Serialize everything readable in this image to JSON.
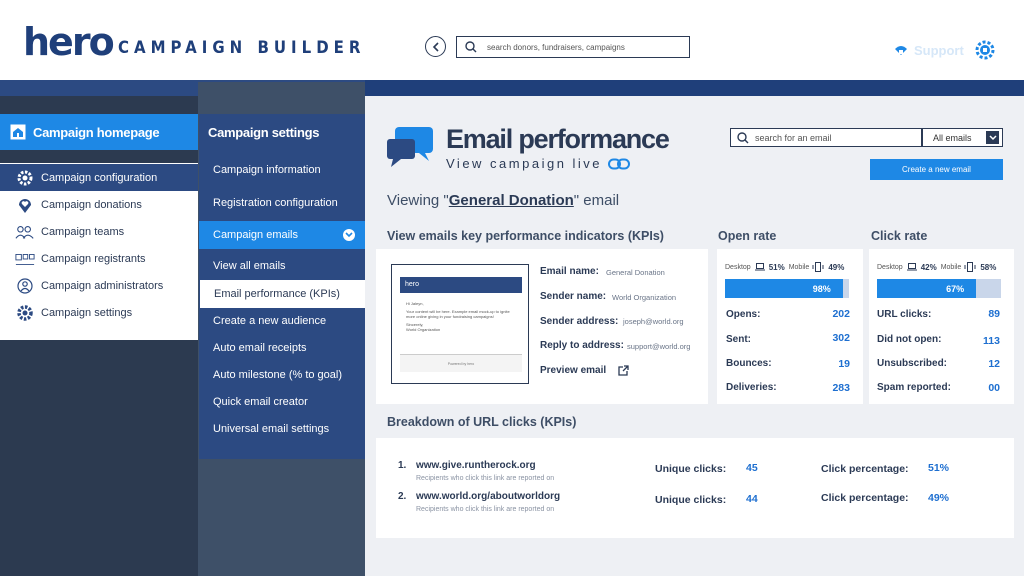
{
  "header": {
    "logo": "hero",
    "app_title": "CAMPAIGN BUILDER",
    "search_placeholder": "search donors, fundraisers, campaigns",
    "support_label": "Support"
  },
  "sidebar": {
    "home_label": "Campaign homepage",
    "items": [
      {
        "label": "Campaign configuration",
        "icon": "gear-cog-icon",
        "active": true
      },
      {
        "label": "Campaign donations",
        "icon": "heart-location-icon"
      },
      {
        "label": "Campaign teams",
        "icon": "team-icon"
      },
      {
        "label": "Campaign registrants",
        "icon": "registrants-icon"
      },
      {
        "label": "Campaign administrators",
        "icon": "admin-fingerprint-icon"
      },
      {
        "label": "Campaign settings",
        "icon": "settings-icon"
      }
    ]
  },
  "settings_nav": {
    "heading": "Campaign settings",
    "items": [
      {
        "label": "Campaign information"
      },
      {
        "label": "Registration configuration"
      },
      {
        "label": "Campaign emails",
        "selected": true
      },
      {
        "label": "View all emails"
      },
      {
        "label": "Email performance (KPIs)",
        "current": true
      },
      {
        "label": "Create a new audience"
      },
      {
        "label": "Auto email receipts"
      },
      {
        "label": "Auto milestone (% to goal)"
      },
      {
        "label": "Quick email creator"
      },
      {
        "label": "Universal email settings"
      }
    ]
  },
  "main": {
    "title": "Email performance",
    "view_live": "View campaign live",
    "viewing_prefix": "Viewing \"",
    "viewing_email": "General Donation",
    "viewing_suffix": "\" email",
    "email_search_placeholder": "search for an email",
    "filter_value": "All emails",
    "create_button": "Create a new email",
    "kpi_heading": "View emails key performance indicators (KPIs)",
    "preview": {
      "brand": "hero",
      "greeting": "Hi Jaleyn,",
      "body": "Your content will be here. Example email mock-up to ignite more online giving in your fundraising campaigns!",
      "signoff": "Sincerely,",
      "org": "World Organization",
      "footer": "Powered by hero"
    },
    "details": [
      {
        "label": "Email name:",
        "value": "General Donation"
      },
      {
        "label": "Sender name:",
        "value": "World Organization"
      },
      {
        "label": "Sender address:",
        "value": "joseph@world.org"
      },
      {
        "label": "Reply to address:",
        "value": "support@world.org"
      }
    ],
    "preview_email_label": "Preview email",
    "open_rate": {
      "heading": "Open rate",
      "desktop_label": "Desktop",
      "desktop_value": "51%",
      "mobile_label": "Mobile",
      "mobile_value": "49%",
      "bar_label": "98%",
      "bar_fraction": 0.95,
      "stats": [
        {
          "label": "Opens:",
          "value": "202"
        },
        {
          "label": "Sent:",
          "value": "302"
        },
        {
          "label": "Bounces:",
          "value": "19"
        },
        {
          "label": "Deliveries:",
          "value": "283"
        }
      ]
    },
    "click_rate": {
      "heading": "Click rate",
      "desktop_label": "Desktop",
      "desktop_value": "42%",
      "mobile_label": "Mobile",
      "mobile_value": "58%",
      "bar_label": "67%",
      "bar_fraction": 0.8,
      "stats": [
        {
          "label": "URL clicks:",
          "value": "89"
        },
        {
          "label": "Did not open:",
          "value": "113"
        },
        {
          "label": "Unsubscribed:",
          "value": "12"
        },
        {
          "label": "Spam reported:",
          "value": "00"
        }
      ]
    },
    "url_heading": "Breakdown of URL clicks (KPIs)",
    "urls": [
      {
        "num": "1.",
        "url": "www.give.runtherock.org",
        "sub": "Recipients who click this link are reported on",
        "unique_label": "Unique clicks:",
        "unique": "45",
        "pct_label": "Click percentage:",
        "pct": "51%"
      },
      {
        "num": "2.",
        "url": "www.world.org/aboutworldorg",
        "sub": "Recipients who click this link are reported on",
        "unique_label": "Unique clicks:",
        "unique": "44",
        "pct_label": "Click percentage:",
        "pct": "49%"
      }
    ]
  },
  "colors": {
    "navy": "#1f3f7a",
    "accent": "#1e88e5",
    "text": "#2b3a55"
  }
}
